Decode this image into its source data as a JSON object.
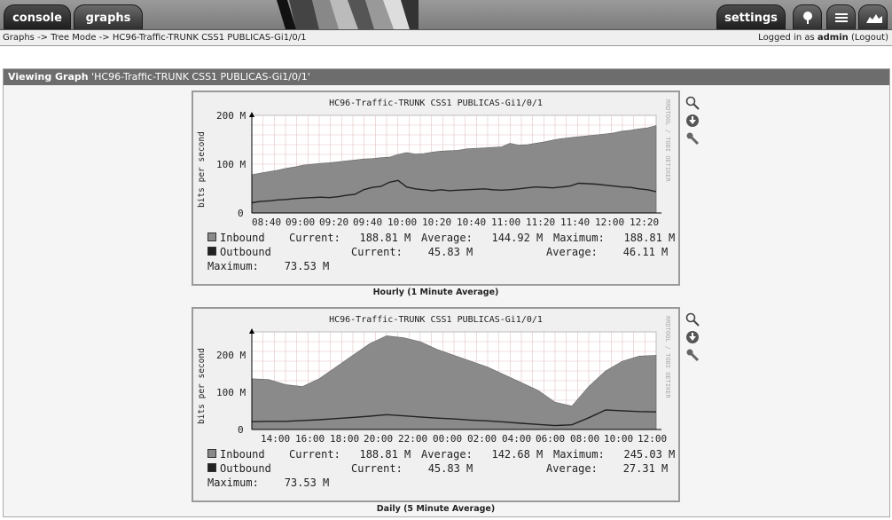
{
  "nav": {
    "console": "console",
    "graphs": "graphs",
    "settings": "settings"
  },
  "breadcrumb": "Graphs -> Tree Mode -> HC96-Traffic-TRUNK CSS1 PUBLICAS-Gi1/0/1",
  "login": {
    "prefix": "Logged in as",
    "user": "admin",
    "logout": "(Logout)"
  },
  "view": {
    "label": "Viewing Graph",
    "name": "'HC96-Traffic-TRUNK CSS1 PUBLICAS-Gi1/0/1'"
  },
  "graphs": [
    {
      "title": "HC96-Traffic-TRUNK CSS1 PUBLICAS-Gi1/0/1",
      "ylabel": "bits per second",
      "side_label": "RRDTOOL / TOBI OETIKER",
      "y_ticks": [
        "200 M",
        "100 M",
        "0"
      ],
      "x_ticks": [
        "08:40",
        "09:00",
        "09:20",
        "09:40",
        "10:00",
        "10:20",
        "10:40",
        "11:00",
        "11:20",
        "11:40",
        "12:00",
        "12:20"
      ],
      "legend": {
        "inbound": "Inbound",
        "outbound": "Outbound",
        "in_current": "Current:   188.81 M",
        "in_average": "Average:   144.92 M",
        "in_max": "Maximum:   188.81 M",
        "out_current": "Current:    45.83 M",
        "out_average": "Average:    46.11 M",
        "out_max": "Maximum:    73.53 M"
      },
      "caption": "Hourly (1 Minute Average)"
    },
    {
      "title": "HC96-Traffic-TRUNK CSS1 PUBLICAS-Gi1/0/1",
      "ylabel": "bits per second",
      "side_label": "RRDTOOL / TOBI OETIKER",
      "y_ticks": [
        "200 M",
        "100 M",
        "0"
      ],
      "x_ticks": [
        "14:00",
        "16:00",
        "18:00",
        "20:00",
        "22:00",
        "00:00",
        "02:00",
        "04:00",
        "06:00",
        "08:00",
        "10:00",
        "12:00"
      ],
      "legend": {
        "inbound": "Inbound",
        "outbound": "Outbound",
        "in_current": "Current:   188.81 M",
        "in_average": "Average:   142.68 M",
        "in_max": "Maximum:   245.03 M",
        "out_current": "Current:    45.83 M",
        "out_average": "Average:    27.31 M",
        "out_max": "Maximum:    73.53 M"
      },
      "caption": "Daily (5 Minute Average)"
    }
  ],
  "chart_data": [
    {
      "type": "area",
      "title": "HC96-Traffic-TRUNK CSS1 PUBLICAS-Gi1/0/1",
      "ylabel": "bits per second",
      "ylim": [
        0,
        210
      ],
      "x": [
        "08:30",
        "08:35",
        "08:40",
        "08:45",
        "08:50",
        "08:55",
        "09:00",
        "09:05",
        "09:10",
        "09:15",
        "09:20",
        "09:25",
        "09:30",
        "09:35",
        "09:40",
        "09:45",
        "09:50",
        "09:55",
        "10:00",
        "10:05",
        "10:10",
        "10:15",
        "10:20",
        "10:25",
        "10:30",
        "10:35",
        "10:40",
        "10:45",
        "10:50",
        "10:55",
        "11:00",
        "11:05",
        "11:10",
        "11:15",
        "11:20",
        "11:25",
        "11:30",
        "11:35",
        "11:40",
        "11:45",
        "11:50",
        "11:55",
        "12:00",
        "12:05",
        "12:10",
        "12:15",
        "12:20",
        "12:25"
      ],
      "series": [
        {
          "name": "Inbound",
          "color": "#8a8a8a",
          "values": [
            82,
            86,
            89,
            92,
            96,
            99,
            103,
            105,
            107,
            108,
            110,
            112,
            114,
            116,
            117,
            119,
            120,
            126,
            130,
            127,
            128,
            131,
            133,
            134,
            135,
            138,
            139,
            140,
            141,
            142,
            150,
            146,
            147,
            150,
            153,
            157,
            160,
            162,
            164,
            166,
            168,
            170,
            172,
            176,
            178,
            181,
            183,
            188
          ]
        },
        {
          "name": "Outbound",
          "color": "#222222",
          "values": [
            22,
            25,
            26,
            28,
            29,
            31,
            32,
            33,
            34,
            33,
            35,
            38,
            40,
            50,
            55,
            57,
            66,
            70,
            56,
            52,
            50,
            48,
            50,
            48,
            49,
            50,
            51,
            52,
            50,
            49,
            50,
            52,
            54,
            56,
            55,
            54,
            56,
            58,
            64,
            63,
            62,
            60,
            58,
            56,
            55,
            52,
            50,
            46
          ]
        }
      ]
    },
    {
      "type": "area",
      "title": "HC96-Traffic-TRUNK CSS1 PUBLICAS-Gi1/0/1",
      "ylabel": "bits per second",
      "ylim": [
        0,
        250
      ],
      "x": [
        "13:00",
        "14:00",
        "15:00",
        "16:00",
        "17:00",
        "18:00",
        "19:00",
        "20:00",
        "21:00",
        "22:00",
        "23:00",
        "00:00",
        "01:00",
        "02:00",
        "03:00",
        "04:00",
        "05:00",
        "06:00",
        "07:00",
        "08:00",
        "09:00",
        "10:00",
        "11:00",
        "12:00",
        "13:00"
      ],
      "series": [
        {
          "name": "Inbound",
          "color": "#8a8a8a",
          "values": [
            130,
            128,
            115,
            110,
            130,
            160,
            190,
            220,
            240,
            235,
            225,
            205,
            190,
            175,
            160,
            140,
            120,
            100,
            70,
            60,
            110,
            150,
            175,
            188,
            190
          ]
        },
        {
          "name": "Outbound",
          "color": "#222222",
          "values": [
            20,
            21,
            21,
            23,
            25,
            28,
            31,
            34,
            38,
            35,
            32,
            29,
            27,
            24,
            22,
            19,
            16,
            13,
            10,
            12,
            30,
            50,
            48,
            46,
            45
          ]
        }
      ]
    }
  ]
}
